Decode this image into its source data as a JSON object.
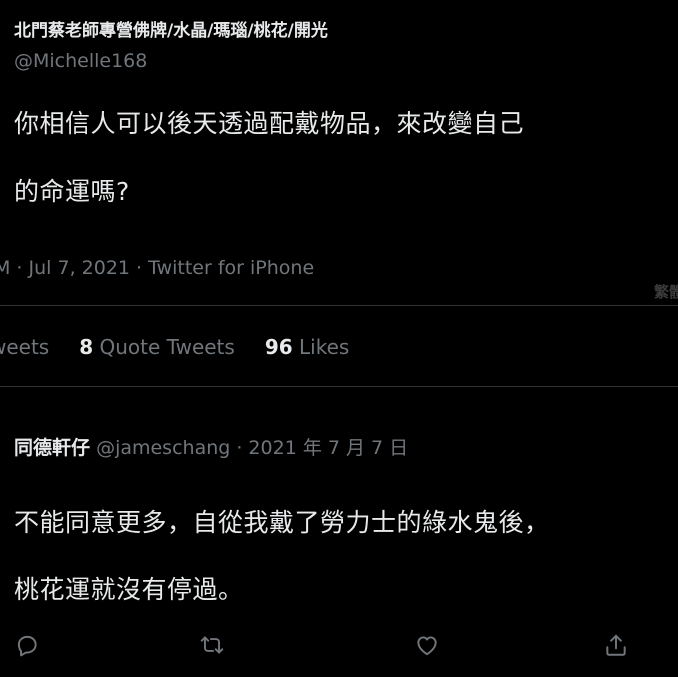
{
  "tweet": {
    "author_name": "北門蔡老師專營佛牌/水晶/瑪瑙/桃花/開光",
    "author_handle": "@Michelle168",
    "text_line1": "你相信人可以後天透過配戴物品，來改變自己",
    "text_line2": "的命運嗎?",
    "meta": "M · Jul 7, 2021 · Twitter for iPhone",
    "translate_label": "繁體"
  },
  "stats": {
    "retweets_label": "weets",
    "quote_count": "8",
    "quote_label": "Quote Tweets",
    "likes_count": "96",
    "likes_label": "Likes"
  },
  "reply": {
    "name": "同德軒仔",
    "handle_date": "@jameschang · 2021 年 7 月 7 日",
    "text_line1": "不能同意更多，自從我戴了勞力士的綠水鬼後，",
    "text_line2": "桃花運就沒有停過。"
  },
  "actions": {
    "icons": [
      "reply-icon",
      "retweet-icon",
      "like-icon",
      "share-icon"
    ],
    "icon_color": "#71767b"
  }
}
